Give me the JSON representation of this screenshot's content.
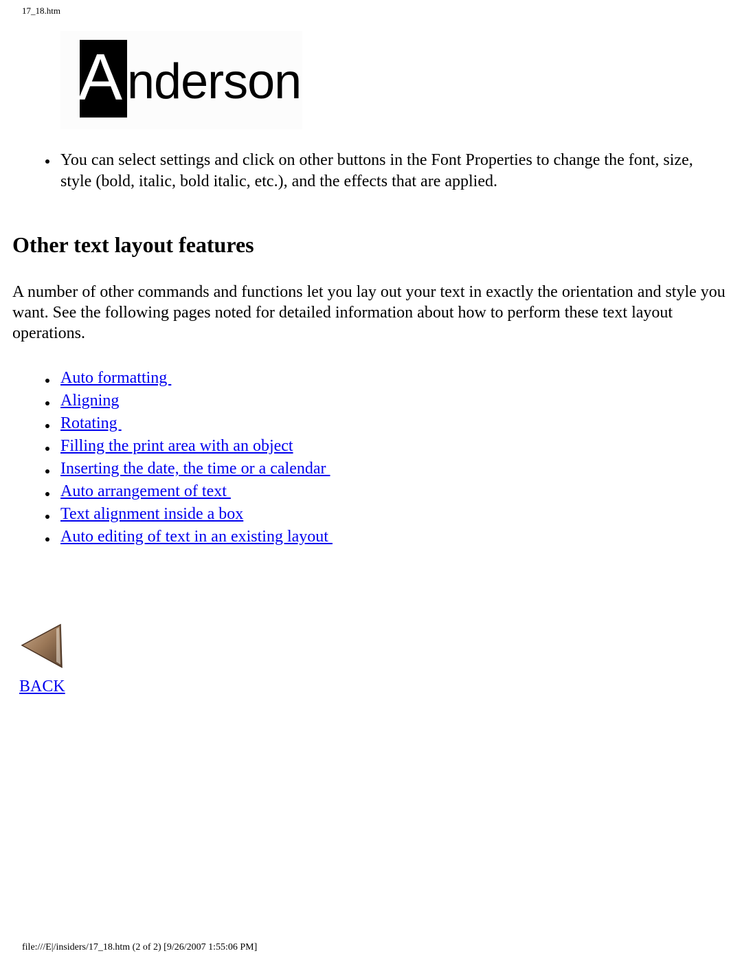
{
  "header": {
    "filename": "17_18.htm"
  },
  "logo": {
    "first_letter": "A",
    "rest": "nderson",
    "alt": "Anderson"
  },
  "intro_bullets": [
    "You can select settings and click on other buttons in the Font Properties to change the font, size, style (bold, italic, bold italic, etc.), and the effects that are applied."
  ],
  "section": {
    "title": "Other text layout features",
    "body": "A number of other commands and functions let you lay out your text in exactly the orientation and style you want. See the following pages noted for detailed information about how to perform these text layout operations."
  },
  "links": [
    {
      "label": "Auto formatting "
    },
    {
      "label": "Aligning"
    },
    {
      "label": "Rotating "
    },
    {
      "label": "Filling the print area with an object"
    },
    {
      "label": "Inserting the date, the time or a calendar "
    },
    {
      "label": "Auto arrangement of text "
    },
    {
      "label": "Text alignment inside a box"
    },
    {
      "label": "Auto editing of text in an existing layout "
    }
  ],
  "navigation": {
    "back_label": "BACK",
    "back_icon": "left-triangle-arrow-icon"
  },
  "colors": {
    "link": "#0000ee",
    "back_arrow": "#8a6a4a"
  },
  "footer": {
    "text": "file:///E|/insiders/17_18.htm (2 of 2) [9/26/2007 1:55:06 PM]"
  }
}
